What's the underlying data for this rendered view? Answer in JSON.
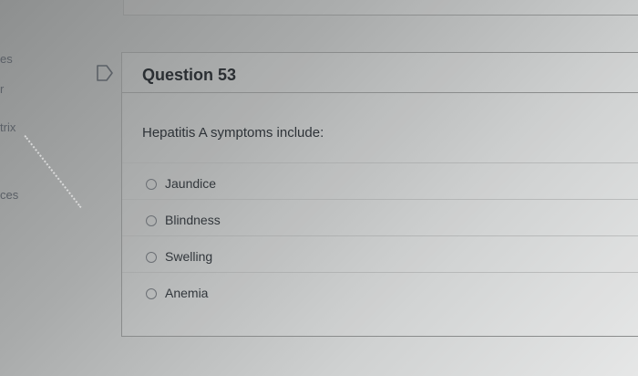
{
  "sidebar": {
    "fragments": [
      "es",
      "r",
      "trix",
      "ces"
    ]
  },
  "question": {
    "title": "Question 53",
    "flag_icon": "flag-icon",
    "text": "Hepatitis A symptoms include:",
    "options": [
      {
        "label": "Jaundice"
      },
      {
        "label": "Blindness"
      },
      {
        "label": "Swelling"
      },
      {
        "label": "Anemia"
      }
    ]
  }
}
